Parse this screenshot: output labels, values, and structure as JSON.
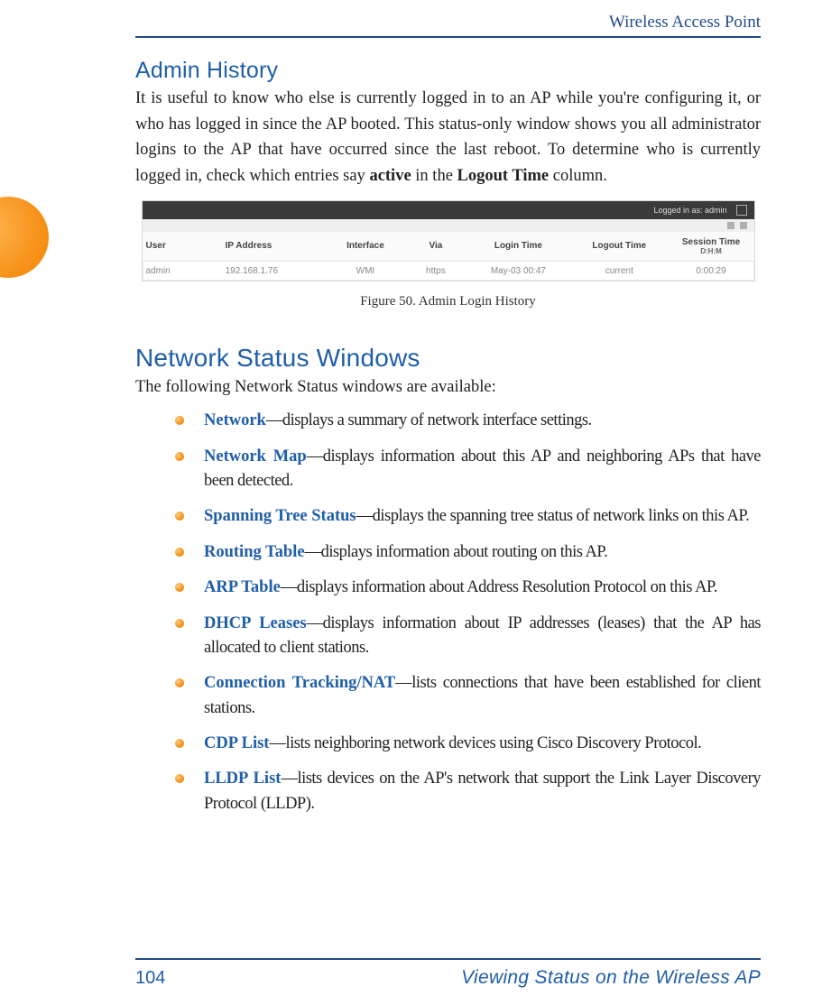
{
  "header": {
    "running_head": "Wireless Access Point"
  },
  "section1": {
    "title": "Admin History",
    "para_lead": "It is useful to know who else is currently logged in to an AP while you're configuring it, or who has logged in since the AP booted. This status-only window shows you all administrator logins to the AP that have occurred since the last reboot. To determine who is currently logged in, check which entries say ",
    "bold1": "active",
    "mid": " in the ",
    "bold2": "Logout Time",
    "tail": " column."
  },
  "figure": {
    "topbar_text": "Logged in as: admin",
    "table": {
      "headers": [
        "User",
        "IP Address",
        "Interface",
        "Via",
        "Login Time",
        "Logout Time",
        "Session Time"
      ],
      "header_sub": "D:H:M",
      "row": [
        "admin",
        "192.168.1.76",
        "WMI",
        "https",
        "May-03 00:47",
        "current",
        "0:00:29"
      ]
    },
    "caption": "Figure 50. Admin Login History"
  },
  "section2": {
    "title": "Network Status Windows",
    "intro": "The following Network Status windows are available:",
    "items": [
      {
        "link": "Network",
        "text": "—displays a summary of network interface settings."
      },
      {
        "link": "Network Map",
        "text": "—displays information about this AP and neighboring APs that have been detected."
      },
      {
        "link": "Spanning Tree Status",
        "text": "—displays the spanning tree status of network links on this AP."
      },
      {
        "link": "Routing Table",
        "text": "—displays information about routing on this AP."
      },
      {
        "link": "ARP Table",
        "text": "—displays information about Address Resolution Protocol on this AP."
      },
      {
        "link": "DHCP Leases",
        "text": "—displays information about IP addresses (leases) that the AP has allocated to client stations."
      },
      {
        "link": "Connection Tracking/NAT",
        "text": "—lists connections that have been established for client stations."
      },
      {
        "link": "CDP List",
        "text": "—lists neighboring network devices using Cisco Discovery Protocol."
      },
      {
        "link": "LLDP List",
        "text": "—lists devices on the AP's network that support the Link Layer Discovery Protocol (LLDP)."
      }
    ]
  },
  "footer": {
    "page": "104",
    "text": "Viewing Status on the Wireless AP"
  }
}
